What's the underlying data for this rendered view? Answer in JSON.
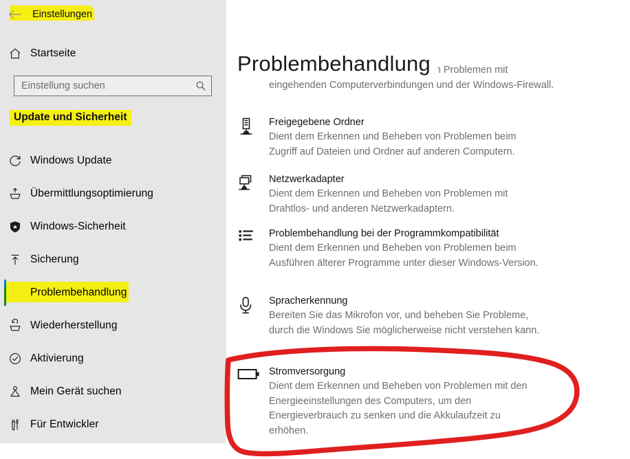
{
  "window": {
    "back_label": "Einstellungen",
    "back_icon": "arrow-left-icon"
  },
  "sidebar": {
    "home": {
      "label": "Startseite",
      "icon": "home-icon"
    },
    "search": {
      "placeholder": "Einstellung suchen",
      "value": "",
      "icon": "search-icon"
    },
    "group_header": "Update und Sicherheit",
    "items": [
      {
        "label": "Windows Update",
        "icon": "refresh-icon",
        "selected": false,
        "highlighted": false
      },
      {
        "label": "Übermittlungsoptimierung",
        "icon": "upload-device-icon",
        "selected": false,
        "highlighted": false
      },
      {
        "label": "Windows-Sicherheit",
        "icon": "shield-icon",
        "selected": false,
        "highlighted": false
      },
      {
        "label": "Sicherung",
        "icon": "upload-arrow-icon",
        "selected": false,
        "highlighted": false
      },
      {
        "label": "Problembehandlung",
        "icon": "wrench-icon",
        "selected": true,
        "highlighted": true
      },
      {
        "label": "Wiederherstellung",
        "icon": "restore-icon",
        "selected": false,
        "highlighted": false
      },
      {
        "label": "Aktivierung",
        "icon": "check-circle-icon",
        "selected": false,
        "highlighted": false
      },
      {
        "label": "Mein Gerät suchen",
        "icon": "find-device-icon",
        "selected": false,
        "highlighted": false
      },
      {
        "label": "Für Entwickler",
        "icon": "developer-tools-icon",
        "selected": false,
        "highlighted": false
      }
    ]
  },
  "main": {
    "title": "Problembehandlung",
    "clipped_item_desc": "Dient dem Erkennen und Beheben von Problemen mit eingehenden Computerverbindungen und der Windows-Firewall.",
    "troubleshooters": [
      {
        "name": "Freigegebene Ordner",
        "desc": "Dient dem Erkennen und Beheben von Problemen beim Zugriff auf Dateien und Ordner auf anderen Computern.",
        "icon": "network-server-icon"
      },
      {
        "name": "Netzwerkadapter",
        "desc": "Dient dem Erkennen und Beheben von Problemen mit Drahtlos- und anderen Netzwerkadaptern.",
        "icon": "network-adapter-icon"
      },
      {
        "name": "Problembehandlung bei der Programmkompatibilität",
        "desc": "Dient dem Erkennen und Beheben von Problemen beim Ausführen älterer Programme unter dieser Windows-Version.",
        "icon": "list-icon"
      },
      {
        "name": "Spracherkennung",
        "desc": "Bereiten Sie das Mikrofon vor, und beheben Sie Probleme, durch die Windows Sie möglicherweise nicht verstehen kann.",
        "icon": "microphone-icon"
      },
      {
        "name": "Stromversorgung",
        "desc": "Dient dem Erkennen und Beheben von Problemen mit den Energieeinstellungen des Computers, um den Energieverbrauch zu senken und die Akkulaufzeit zu erhöhen.",
        "icon": "battery-icon"
      }
    ]
  },
  "annotations": {
    "highlight_color": "#f5ef13",
    "circle_color": "#e01f1f",
    "accent_color": "#0078d7",
    "accent_secondary": "#0f8a1a",
    "circled_item": "Stromversorgung"
  }
}
